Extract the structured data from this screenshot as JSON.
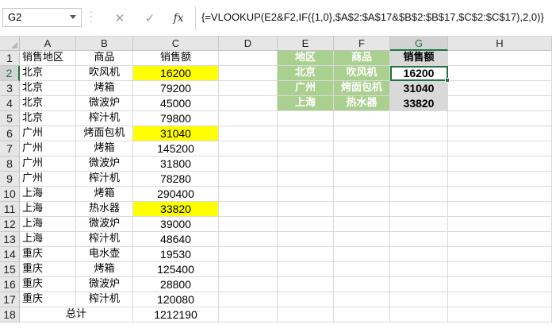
{
  "formula_bar": {
    "name_box": "G2",
    "cancel_icon": "✕",
    "enter_icon": "✓",
    "fx_label": "fx",
    "formula": "{=VLOOKUP(E2&F2,IF({1,0},$A$2:$A$17&$B$2:$B$17,$C$2:$C$17),2,0)}"
  },
  "columns": [
    "A",
    "B",
    "C",
    "D",
    "E",
    "F",
    "G",
    "H"
  ],
  "rows": [
    "1",
    "2",
    "3",
    "4",
    "5",
    "6",
    "7",
    "8",
    "9",
    "10",
    "11",
    "12",
    "13",
    "14",
    "15",
    "16",
    "17",
    "18"
  ],
  "sheet": {
    "header": {
      "region": "销售地区",
      "product": "商品",
      "sales": "销售额"
    },
    "data": [
      {
        "region": "北京",
        "product": "吹风机",
        "sales": "16200"
      },
      {
        "region": "北京",
        "product": "烤箱",
        "sales": "79200"
      },
      {
        "region": "北京",
        "product": "微波炉",
        "sales": "45000"
      },
      {
        "region": "北京",
        "product": "榨汁机",
        "sales": "79800"
      },
      {
        "region": "广州",
        "product": "烤面包机",
        "sales": "31040"
      },
      {
        "region": "广州",
        "product": "烤箱",
        "sales": "145200"
      },
      {
        "region": "广州",
        "product": "微波炉",
        "sales": "31800"
      },
      {
        "region": "广州",
        "product": "榨汁机",
        "sales": "78280"
      },
      {
        "region": "上海",
        "product": "烤箱",
        "sales": "290400"
      },
      {
        "region": "上海",
        "product": "热水器",
        "sales": "33820"
      },
      {
        "region": "上海",
        "product": "微波炉",
        "sales": "39000"
      },
      {
        "region": "上海",
        "product": "榨汁机",
        "sales": "48640"
      },
      {
        "region": "重庆",
        "product": "电水壶",
        "sales": "19530"
      },
      {
        "region": "重庆",
        "product": "烤箱",
        "sales": "125400"
      },
      {
        "region": "重庆",
        "product": "微波炉",
        "sales": "28800"
      },
      {
        "region": "重庆",
        "product": "榨汁机",
        "sales": "120080"
      }
    ],
    "total_label": "总计",
    "total_value": "1212190"
  },
  "lookup": {
    "header": {
      "region": "地区",
      "product": "商品",
      "sales": "销售额"
    },
    "rows": [
      {
        "region": "北京",
        "product": "吹风机",
        "sales": "16200"
      },
      {
        "region": "广州",
        "product": "烤面包机",
        "sales": "31040"
      },
      {
        "region": "上海",
        "product": "热水器",
        "sales": "33820"
      }
    ]
  },
  "colors": {
    "highlight": "#ffff00",
    "lookup_header": "#a9d08e",
    "selection": "#217346"
  }
}
